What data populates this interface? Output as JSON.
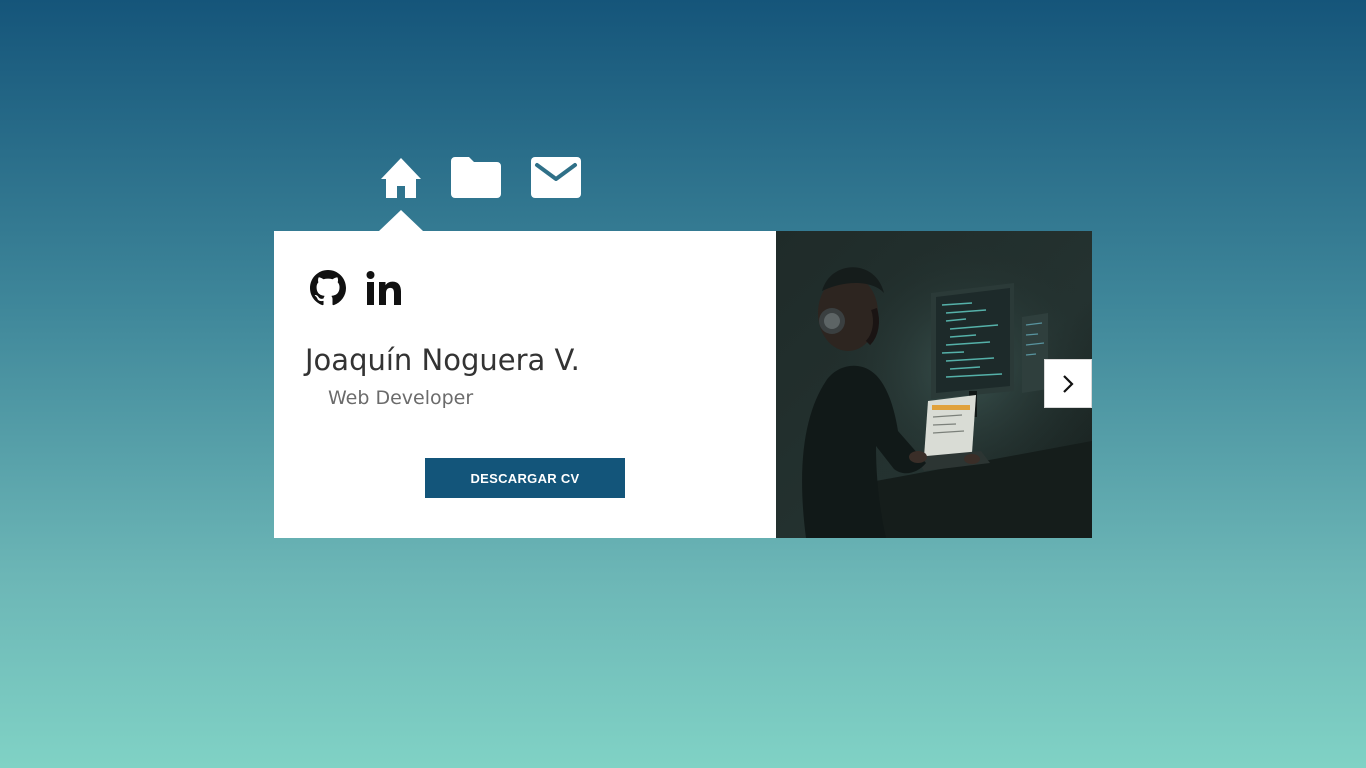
{
  "nav": {
    "items": [
      {
        "icon": "home-icon",
        "active": true
      },
      {
        "icon": "folder-icon",
        "active": false
      },
      {
        "icon": "mail-icon",
        "active": false
      }
    ]
  },
  "profile": {
    "social": [
      {
        "icon": "github-icon"
      },
      {
        "icon": "linkedin-icon"
      }
    ],
    "name": "Joaquín Noguera V.",
    "role": "Web Developer",
    "cv_button_label": "DESCARGAR CV"
  },
  "gallery": {
    "image": "developer-at-computer-photo",
    "next_icon": "chevron-right-icon"
  },
  "colors": {
    "button_bg": "#13557a",
    "background_top": "#15557a",
    "background_bottom": "#80d2c5"
  }
}
